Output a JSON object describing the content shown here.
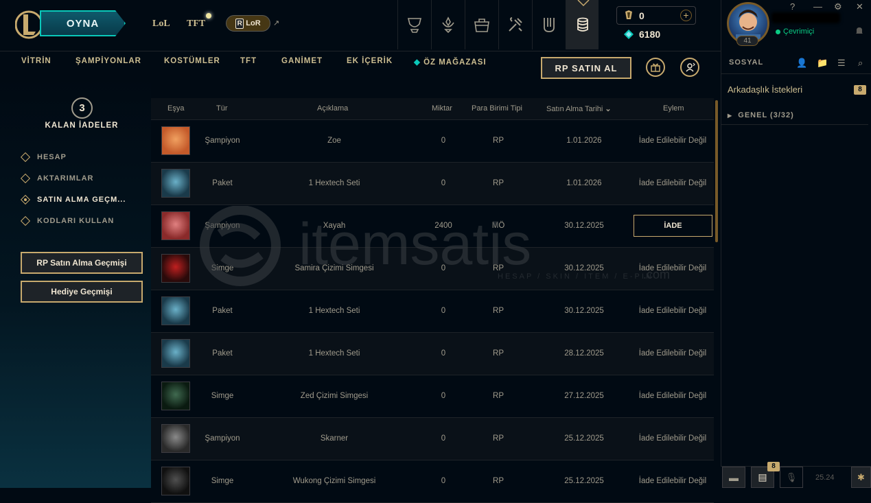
{
  "topbar": {
    "play_label": "OYNA",
    "games": [
      "LoL",
      "TFT"
    ],
    "lor_label": "LoR",
    "nav_icons": [
      "trophy-icon",
      "champion-icon",
      "collection-icon",
      "crafting-icon",
      "clash-icon",
      "store-icon"
    ],
    "wallet": {
      "rp": "0",
      "blue_essence": "6180"
    }
  },
  "subnav": {
    "items": [
      "VİTRİN",
      "ŞAMPİYONLAR",
      "KOSTÜMLER",
      "TFT",
      "GANİMET",
      "EK İÇERİK",
      "ÖZ MAĞAZASI"
    ],
    "rp_button": "RP SATIN AL"
  },
  "sidebar": {
    "refunds_count": "3",
    "refunds_label": "KALAN İADELER",
    "items": [
      {
        "label": "HESAP"
      },
      {
        "label": "AKTARIMLAR"
      },
      {
        "label": "SATIN ALMA GEÇM..."
      },
      {
        "label": "KODLARI KULLAN"
      }
    ],
    "active_index": 2,
    "buttons": [
      "RP Satın Alma Geçmişi",
      "Hediye Geçmişi"
    ]
  },
  "table": {
    "headers": [
      "Eşya",
      "Tür",
      "Açıklama",
      "Miktar",
      "Para Birimi Tipi",
      "Satın Alma Tarihi",
      "Eylem"
    ],
    "rows": [
      {
        "type": "Şampiyon",
        "desc": "Zoe",
        "amount": "0",
        "currency": "RP",
        "date": "1.01.2026",
        "action": "İade Edilebilir Değil"
      },
      {
        "type": "Paket",
        "desc": "1 Hextech Seti",
        "amount": "0",
        "currency": "RP",
        "date": "1.01.2026",
        "action": "İade Edilebilir Değil"
      },
      {
        "type": "Şampiyon",
        "desc": "Xayah",
        "amount": "2400",
        "currency": "MÖ",
        "date": "30.12.2025",
        "action": "İADE"
      },
      {
        "type": "Simge",
        "desc": "Samira Çizimi Simgesi",
        "amount": "0",
        "currency": "RP",
        "date": "30.12.2025",
        "action": "İade Edilebilir Değil"
      },
      {
        "type": "Paket",
        "desc": "1 Hextech Seti",
        "amount": "0",
        "currency": "RP",
        "date": "30.12.2025",
        "action": "İade Edilebilir Değil"
      },
      {
        "type": "Paket",
        "desc": "1 Hextech Seti",
        "amount": "0",
        "currency": "RP",
        "date": "28.12.2025",
        "action": "İade Edilebilir Değil"
      },
      {
        "type": "Simge",
        "desc": "Zed Çizimi Simgesi",
        "amount": "0",
        "currency": "RP",
        "date": "27.12.2025",
        "action": "İade Edilebilir Değil"
      },
      {
        "type": "Şampiyon",
        "desc": "Skarner",
        "amount": "0",
        "currency": "RP",
        "date": "25.12.2025",
        "action": "İade Edilebilir Değil"
      },
      {
        "type": "Simge",
        "desc": "Wukong Çizimi Simgesi",
        "amount": "0",
        "currency": "RP",
        "date": "25.12.2025",
        "action": "İade Edilebilir Değil"
      }
    ]
  },
  "watermark": {
    "brand": "itemsatis",
    "tagline": "HESAP / SKIN / ITEM / E-PIN",
    "suffix": ".com"
  },
  "social": {
    "level": "41",
    "status": "Çevrimiçi",
    "title": "SOSYAL",
    "friend_requests": "Arkadaşlık İstekleri",
    "friend_requests_count": "8",
    "group": "GENEL (3/32)",
    "notif_count": "8",
    "version": "25.24",
    "help": "?"
  },
  "colors": {
    "gold": "#c8aa6e",
    "teal": "#0ac8b9",
    "online": "#0acb83",
    "bg": "#010a13"
  }
}
